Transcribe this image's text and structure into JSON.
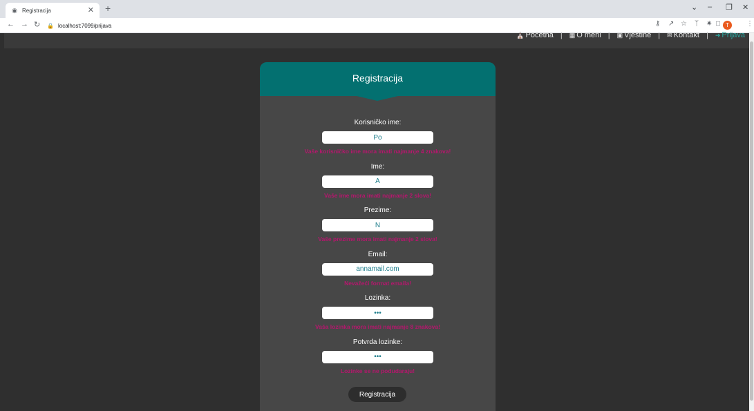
{
  "browser": {
    "tab_title": "Registracija",
    "new_tab": "+",
    "url": "localhost:7099/prijava",
    "profile_initial": "T"
  },
  "nav": {
    "items": [
      {
        "label": "Početna"
      },
      {
        "label": "O meni"
      },
      {
        "label": "Vještine"
      },
      {
        "label": "Kontakt"
      },
      {
        "label": "Prijava"
      }
    ],
    "separator": "|",
    "active_color": "#2aa7a0"
  },
  "form": {
    "title": "Registracija",
    "header_color": "#037070",
    "fields": [
      {
        "label": "Korisničko ime:",
        "value": "Po",
        "error": "Vaše korisničko ime mora imati najmanje 4 znakova!"
      },
      {
        "label": "Ime:",
        "value": "A",
        "error": "Vaše ime mora imati najmanje 2 slova!"
      },
      {
        "label": "Prezime:",
        "value": "N",
        "error": "Vaše prezime mora imati najmanje 2 slova!"
      },
      {
        "label": "Email:",
        "value": "annamail.com",
        "error": "Nevažeći format emaila!"
      },
      {
        "label": "Lozinka:",
        "value": "•••",
        "error": "Vaša lozinka mora imati najmanje 8 znakova!"
      },
      {
        "label": "Potvrda lozinke:",
        "value": "•••",
        "error": "Lozinke se ne podudaraju!"
      }
    ],
    "submit_label": "Registracija",
    "error_color": "#b5176d"
  }
}
